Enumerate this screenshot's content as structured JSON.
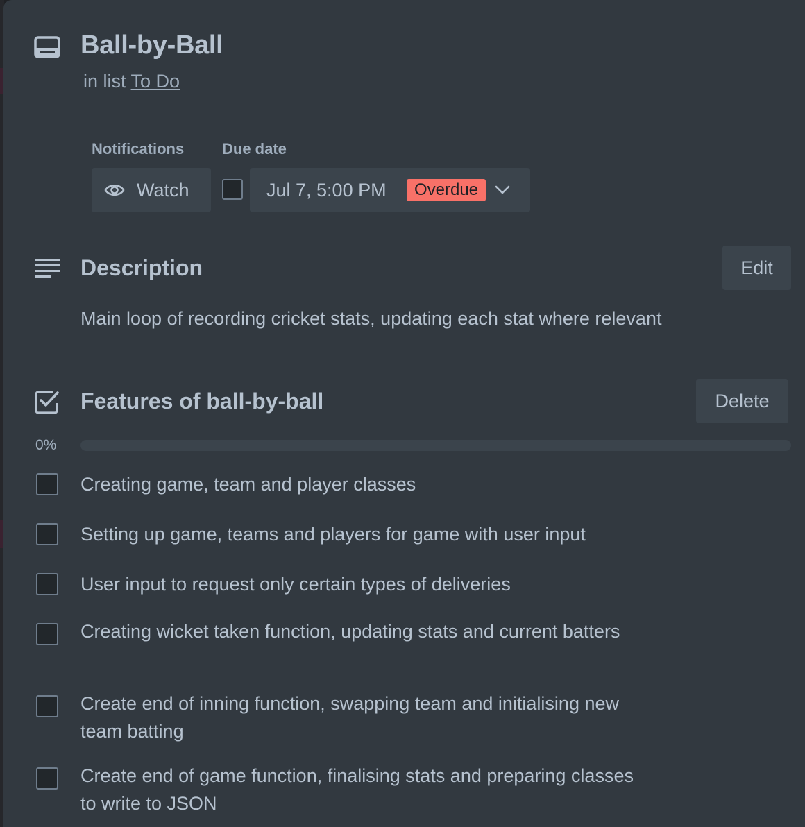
{
  "card": {
    "title": "Ball-by-Ball",
    "in_list_prefix": "in list",
    "list_name": "To Do"
  },
  "notifications": {
    "label": "Notifications",
    "watch_label": "Watch"
  },
  "due_date": {
    "label": "Due date",
    "value": "Jul 7, 5:00 PM",
    "status": "Overdue",
    "complete": false
  },
  "description": {
    "title": "Description",
    "edit_label": "Edit",
    "text": "Main loop of recording cricket stats, updating each stat where relevant"
  },
  "checklist": {
    "title": "Features of ball-by-ball",
    "delete_label": "Delete",
    "progress_label": "0%",
    "progress_fraction": 0.0,
    "items": [
      {
        "text": "Creating game, team and player classes",
        "checked": false
      },
      {
        "text": "Setting up game, teams and players for game with user input",
        "checked": false
      },
      {
        "text": "User input to request only certain types of deliveries",
        "checked": false
      },
      {
        "text": "Creating wicket taken function, updating stats and current batters",
        "checked": false
      },
      {
        "text": "Create end of inning function, swapping team and initialising new team batting",
        "checked": false
      },
      {
        "text": "Create end of game function, finalising stats and preparing classes to write to JSON",
        "checked": false
      }
    ]
  },
  "colors": {
    "modal_bg": "#323940",
    "button_bg": "#3b444c",
    "text": "#b6c2cf",
    "overdue_badge": "#f87168",
    "progress_fill": "#4bce97"
  }
}
